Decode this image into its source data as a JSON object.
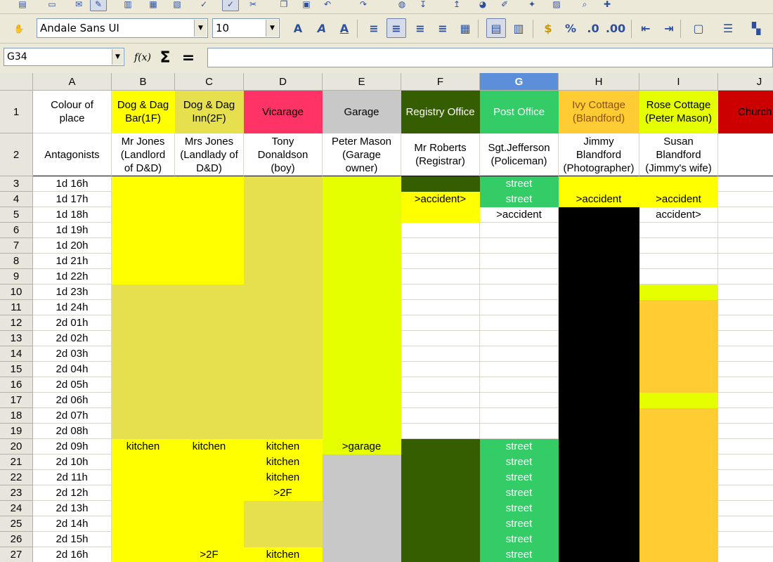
{
  "toolbar": {
    "font_name": "Andale Sans UI",
    "font_size": "10",
    "icons": [
      "new-icon",
      "save-icon",
      "email-icon",
      "edit-file-icon",
      "export-pdf-icon",
      "print-icon",
      "print-preview-icon",
      "spellcheck-icon",
      "autospellcheck-icon",
      "cut-icon",
      "copy-icon",
      "paste-icon",
      "undo-icon",
      "redo-icon",
      "hyperlink-icon",
      "sort-ascending-icon",
      "sort-descending-icon",
      "chart-icon",
      "draw-functions-icon",
      "navigator-icon",
      "gallery-icon",
      "find-icon",
      "help-icon"
    ],
    "format_icons": [
      "styles-icon",
      "bold-icon",
      "italic-icon",
      "underline-icon",
      "align-left-icon",
      "align-center-icon",
      "align-right-icon",
      "justify-icon",
      "merge-cells-icon",
      "wrap-text-icon",
      "align-top-icon",
      "currency-icon",
      "percent-icon",
      "add-decimal-icon",
      "delete-decimal-icon",
      "decrease-indent-icon",
      "increase-indent-icon",
      "borders-icon",
      "line-style-icon",
      "background-color-icon"
    ]
  },
  "formula_bar": {
    "name_box": "G34",
    "function_wizard": "f(x)",
    "sum": "Σ",
    "equals": "=",
    "content": ""
  },
  "columns": [
    "A",
    "B",
    "C",
    "D",
    "E",
    "F",
    "G",
    "H",
    "I",
    "J"
  ],
  "selected_column": "G",
  "rows": [
    "1",
    "2",
    "3",
    "4",
    "5",
    "6",
    "7",
    "8",
    "9",
    "10",
    "11",
    "12",
    "13",
    "14",
    "15",
    "16",
    "17",
    "18",
    "19",
    "20",
    "21",
    "22",
    "23",
    "24",
    "25",
    "26",
    "27"
  ],
  "places": [
    "Colour of\nplace",
    "Dog & Dag\nBar(1F)",
    "Dog & Dag\nInn(2F)",
    "Vicarage",
    "Garage",
    "Registry Office",
    "Post Office",
    "Ivy Cottage\n(Blandford)",
    "Rose Cottage\n(Peter Mason)",
    "Church"
  ],
  "antagonists": [
    "Antagonists",
    "Mr Jones\n(Landlord\nof D&D)",
    "Mrs Jones\n(Landlady of\nD&D)",
    "Tony\nDonaldson\n(boy)",
    "Peter Mason\n(Garage\nowner)",
    "Mr Roberts\n(Registrar)",
    "Sgt.Jefferson\n(Policeman)",
    "Jimmy\nBlandford\n(Photographer)",
    "Susan\nBlandford\n(Jimmy's wife)",
    ""
  ],
  "times": [
    "1d 16h",
    "1d 17h",
    "1d 18h",
    "1d 19h",
    "1d 20h",
    "1d 21h",
    "1d 22h",
    "1d 23h",
    "1d 24h",
    "2d 01h",
    "2d 02h",
    "2d 03h",
    "2d 04h",
    "2d 05h",
    "2d 06h",
    "2d 07h",
    "2d 08h",
    "2d 09h",
    "2d 10h",
    "2d 11h",
    "2d 12h",
    "2d 13h",
    "2d 14h",
    "2d 15h",
    "2d 16h"
  ],
  "colors": {
    "yellow": "#ffff00",
    "khaki": "#e6e04f",
    "lime": "#e6ff00",
    "grey": "#c8c8c8",
    "darkgreen": "#355e00",
    "green": "#33cc66",
    "orange": "#ffcc33",
    "black": "#000000",
    "pink": "#ff3366",
    "red": "#cc0000",
    "white": "#ffffff"
  },
  "cells": {
    "B": {
      "20": "kitchen"
    },
    "C": {
      "20": "kitchen",
      "27": ">2F"
    },
    "D": {
      "20": "kitchen",
      "21": "kitchen",
      "22": "kitchen",
      "23": ">2F",
      "27": "kitchen"
    },
    "E": {
      "20": ">garage"
    },
    "F": {
      "4": ">accident>"
    },
    "G": {
      "3": "street",
      "4": "street",
      "5": ">accident",
      "20": "street",
      "21": "street",
      "22": "street",
      "23": "street",
      "24": "street",
      "25": "street",
      "26": "street",
      "27": "street"
    },
    "H": {
      "4": ">accident"
    },
    "I": {
      "4": ">accident",
      "5": "accident>"
    }
  }
}
